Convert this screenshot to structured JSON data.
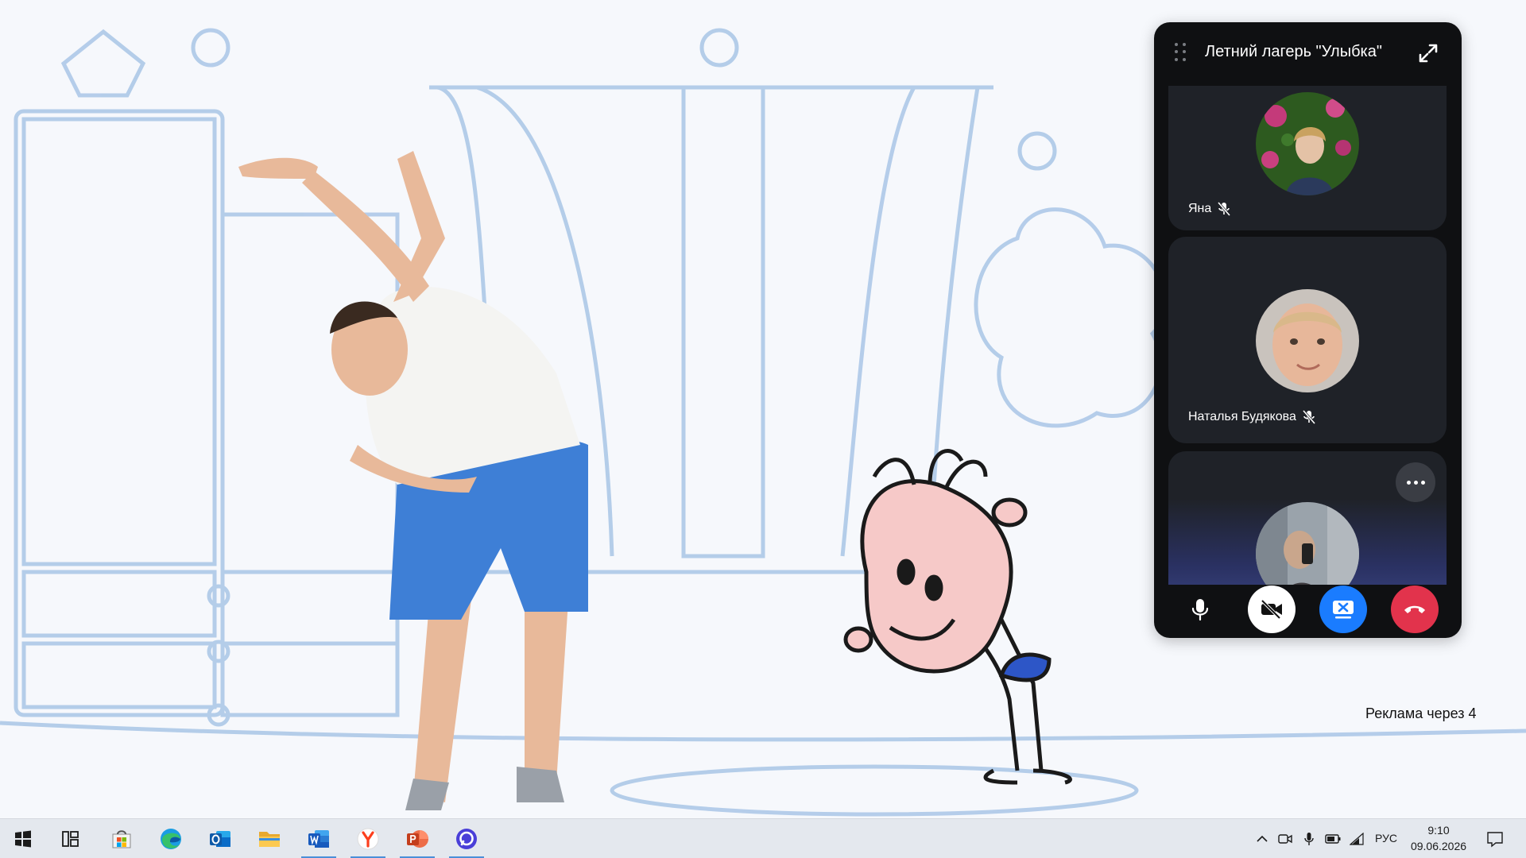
{
  "video": {
    "ad_notice": "Реклама через 4"
  },
  "call_widget": {
    "title": "Летний лагерь \"Улыбка\"",
    "participants": [
      {
        "name": "Яна",
        "muted": true,
        "icon": "mic-off-icon"
      },
      {
        "name": "Наталья Будякова",
        "muted": true,
        "icon": "mic-off-icon"
      },
      {
        "name": "",
        "muted": false,
        "icon": ""
      }
    ],
    "controls": [
      {
        "name": "microphone",
        "icon": "microphone-icon",
        "color": "#ffffff"
      },
      {
        "name": "camera-off",
        "icon": "video-off-icon",
        "color": "#ffffff"
      },
      {
        "name": "screen-share",
        "icon": "screen-share-stop-icon",
        "color": "#1a7cff"
      },
      {
        "name": "end-call",
        "icon": "phone-hangup-icon",
        "color": "#e2334c"
      }
    ]
  },
  "taskbar": {
    "pinned_apps": [
      {
        "name": "start",
        "icon": "windows-start-icon"
      },
      {
        "name": "task-view",
        "icon": "task-view-icon"
      },
      {
        "name": "microsoft-store",
        "icon": "store-icon"
      },
      {
        "name": "edge",
        "icon": "edge-icon"
      },
      {
        "name": "outlook",
        "icon": "outlook-icon"
      },
      {
        "name": "file-explorer",
        "icon": "folder-icon"
      },
      {
        "name": "word",
        "icon": "word-icon"
      },
      {
        "name": "yandex-browser",
        "icon": "yandex-icon"
      },
      {
        "name": "powerpoint",
        "icon": "powerpoint-icon"
      },
      {
        "name": "messenger",
        "icon": "messenger-icon"
      }
    ],
    "tray": {
      "language": "РУС",
      "time": "9:10",
      "date": "09.06.2026"
    }
  }
}
